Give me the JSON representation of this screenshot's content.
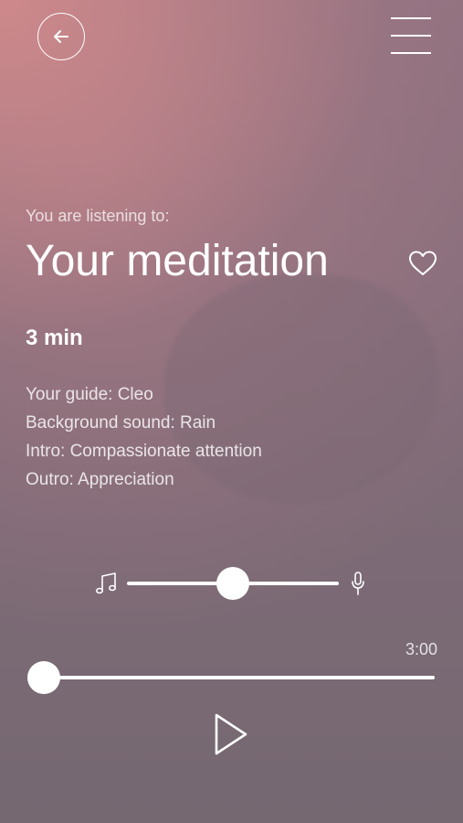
{
  "header": {
    "back_icon": "arrow-left-icon",
    "menu_icon": "hamburger-menu-icon"
  },
  "now_playing": {
    "subtitle": "You are listening to:",
    "title": "Your meditation",
    "favorite_icon": "heart-outline-icon",
    "duration": "3 min"
  },
  "details": {
    "guide": "Your guide: Cleo",
    "background_sound": "Background sound: Rain",
    "intro": "Intro: Compassionate attention",
    "outro": "Outro: Appreciation"
  },
  "mix": {
    "left_icon": "music-note-icon",
    "right_icon": "microphone-icon",
    "balance": 0.5
  },
  "player": {
    "total_time": "3:00",
    "progress": 0.0,
    "play_icon": "play-icon"
  }
}
